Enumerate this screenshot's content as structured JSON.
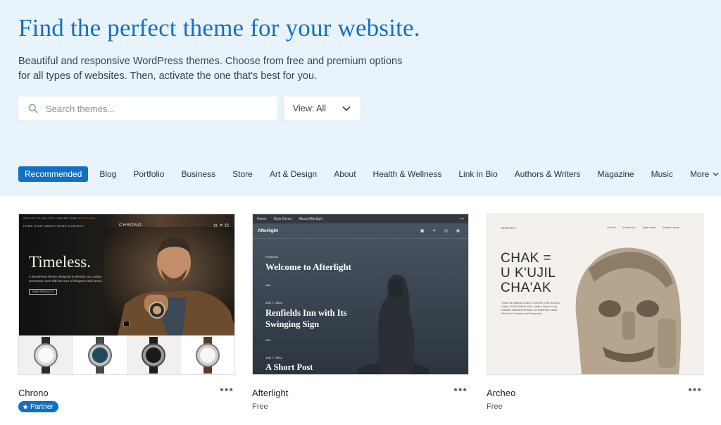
{
  "hero": {
    "title": "Find the perfect theme for your website.",
    "subtitle_line1": "Beautiful and responsive WordPress themes. Choose from free and premium options",
    "subtitle_line2": "for all types of websites. Then, activate the one that's best for you."
  },
  "search": {
    "placeholder": "Search themes..."
  },
  "view": {
    "label": "View: All"
  },
  "categories": [
    "Recommended",
    "Blog",
    "Portfolio",
    "Business",
    "Store",
    "Art & Design",
    "About",
    "Health & Wellness",
    "Link in Bio",
    "Authors & Writers",
    "Magazine",
    "Music",
    "More"
  ],
  "colors": {
    "accent": "#1270c3",
    "hero_bg": "#e8f3fc"
  },
  "themes": [
    {
      "name": "Chrono",
      "badge": "Partner",
      "preview": {
        "promo": "GET UP TO 40% OFF LIMITED TIME",
        "promo_link": "SHOP NOW",
        "nav": "HOME   SHOP   ABOUT   NEWS   CONTACT",
        "logo": "CHRONO",
        "title": "Timeless.",
        "desc": "A WordPress theme designed to elevate your online accessory store with an aura of elegance and luxury.",
        "button": "SHOP PRODUCTS"
      }
    },
    {
      "name": "Afterlight",
      "price": "Free",
      "preview": {
        "nav": [
          "Home",
          "Style Demo",
          "About Afterlight"
        ],
        "brand": "Afterlight",
        "label1": "Featured",
        "heading1": "Welcome to Afterlight",
        "label2": "July 7, 2011",
        "heading2_line1": "Renfields Inn with Its",
        "heading2_line2": "Swinging Sign",
        "label3": "July 7, 2011",
        "heading3": "A Short Post"
      }
    },
    {
      "name": "Archeo",
      "price": "Free",
      "preview": {
        "logo": "ARCHEO",
        "nav": [
          "Xe Ferd",
          "Karabel Xiv",
          "Talpe arable",
          "Adabel Lasuab"
        ],
        "title_line1": "CHAK =",
        "title_line2": "U K'UJIL",
        "title_line3": "CHA'AK",
        "body": "Tz'ab'e ta yetsecal Ch'ab'a' ti Xachme' u Bet ch'a'an u chaak, u k'aba' ti'ala'te ri'ala' u chak u k'uyuch u kaj chaak'an ti'ala'kabi ii te'ka'ok: ich Tzaba'ana u tiinta' bi'ka'ab j'a. Yuxasah yaak Campeche"
      }
    }
  ]
}
